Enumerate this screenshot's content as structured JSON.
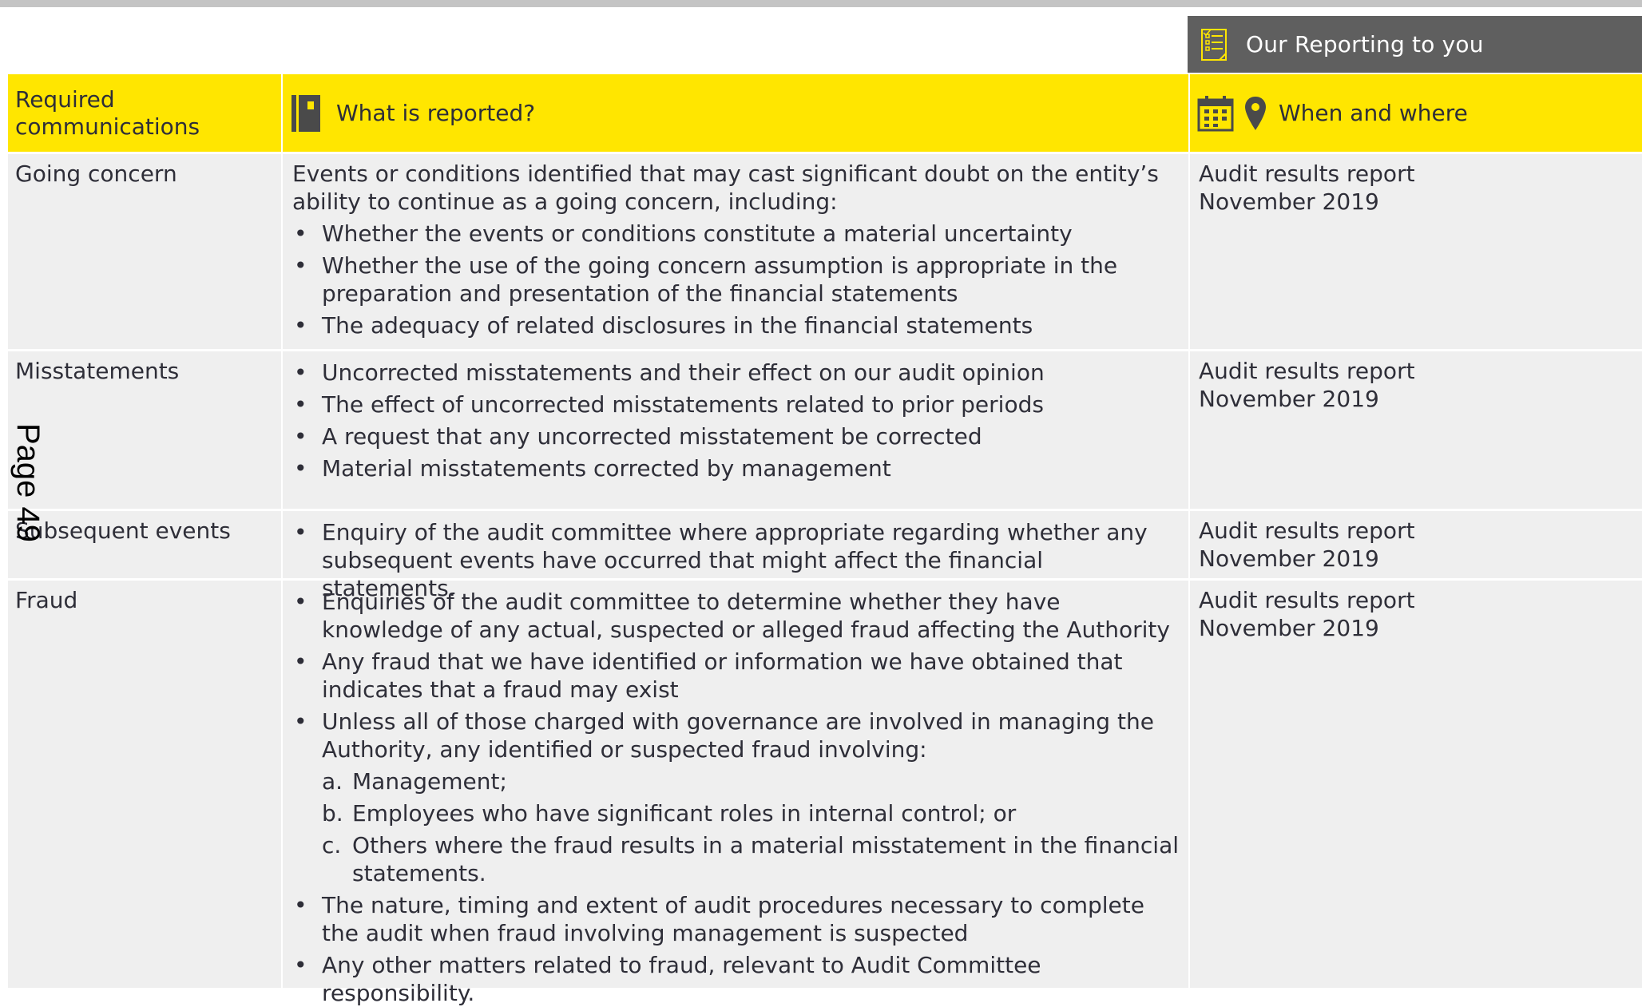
{
  "banner": {
    "title": "Our Reporting to you",
    "icon": "checklist-icon"
  },
  "header": {
    "col1": "Required communications",
    "col2": "What is reported?",
    "col3": "When and where",
    "col2_icon": "notebook-icon",
    "col3_icons": [
      "calendar-icon",
      "location-pin-icon"
    ]
  },
  "rows": [
    {
      "name": "Going concern",
      "intro": "Events or conditions identified that may cast significant doubt on the entity’s ability to continue as a going concern, including:",
      "bullets": [
        "Whether the events or conditions constitute a material uncertainty",
        "Whether the use of the going concern assumption is appropriate in the preparation and presentation of the financial statements",
        "The adequacy of related disclosures in the financial statements"
      ],
      "when": [
        "Audit results report",
        "November 2019"
      ]
    },
    {
      "name": "Misstatements",
      "bullets": [
        "Uncorrected misstatements and their effect on our audit opinion",
        "The effect of uncorrected misstatements related to prior periods",
        "A request that any uncorrected misstatement be corrected",
        "Material misstatements corrected by management"
      ],
      "when": [
        "Audit results report",
        "November 2019"
      ]
    },
    {
      "name": "Subsequent events",
      "bullets": [
        "Enquiry of the audit committee where appropriate regarding whether any subsequent events have occurred that might affect the financial statements."
      ],
      "when": [
        "Audit results report",
        "November 2019"
      ]
    },
    {
      "name": "Fraud",
      "bullets": [
        "Enquiries of the audit committee to determine whether they have knowledge of any actual, suspected or alleged fraud affecting the Authority",
        "Any fraud that we have identified or information we have obtained that indicates that a fraud may exist",
        "Unless all of those charged with governance are involved in managing the Authority, any identified or suspected fraud involving:",
        "The nature, timing and extent of audit procedures necessary to complete the audit when fraud involving management is suspected",
        "Any other matters related to fraud, relevant to Audit Committee responsibility."
      ],
      "sub": [
        {
          "marker": "a.",
          "text": "Management;"
        },
        {
          "marker": "b.",
          "text": "Employees who have significant roles in internal control; or"
        },
        {
          "marker": "c.",
          "text": "Others where the fraud results in a material misstatement in the financial statements."
        }
      ],
      "when": [
        "Audit results report",
        "November 2019"
      ]
    }
  ],
  "page_label": "Page 49",
  "colors": {
    "yellow": "#ffe600",
    "banner": "#5f5f5f",
    "cell": "#efefef",
    "text": "#2e2e38"
  }
}
